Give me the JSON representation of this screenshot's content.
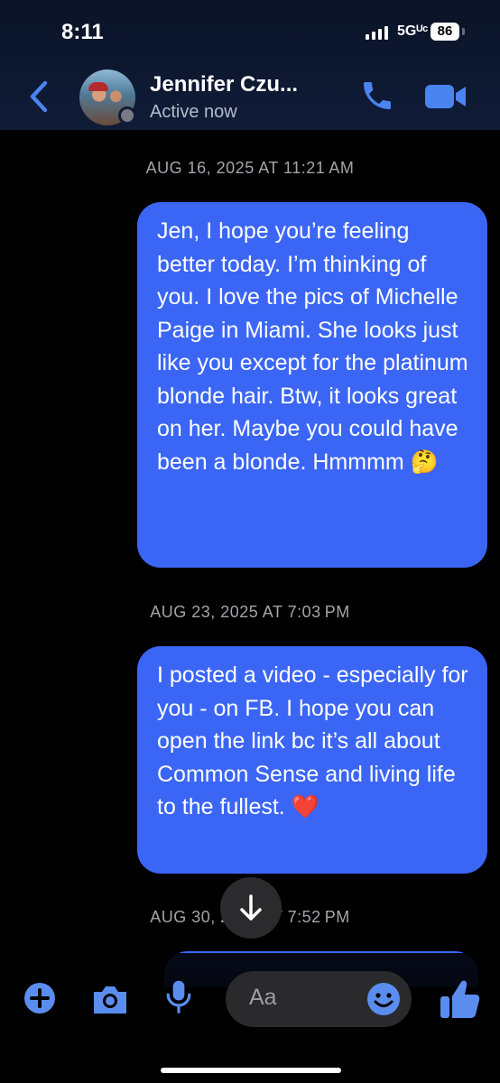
{
  "status_bar": {
    "time": "8:11",
    "network": "5Gᵁᶜ",
    "battery": "86"
  },
  "header": {
    "contact_name": "Jennifer Czu...",
    "status": "Active now"
  },
  "messages": [
    {
      "timestamp": "AUG 16, 2025 AT 11:21 AM",
      "text": "Jen, I hope you’re feeling better today. I’m thinking of you. I love the pics of Michelle Paige in Miami. She looks just like you except for the platinum blonde hair. Btw, it looks great on her. Maybe you could have been a blonde. Hmmmm 🤔"
    },
    {
      "timestamp": "AUG 23, 2025 AT 7:03 PM",
      "text": "I posted a video - especially for you - on FB. I hope you can open the link bc  it’s all about Common Sense and living life to the fullest. ❤️"
    },
    {
      "timestamp": "AUG 30, 2025 AT 7:52 PM",
      "text": ""
    }
  ],
  "composer": {
    "placeholder": "Aa"
  },
  "colors": {
    "accent": "#3b66f5",
    "icon_blue": "#5b8def",
    "background": "#000000",
    "header_bg": "#101c38"
  }
}
